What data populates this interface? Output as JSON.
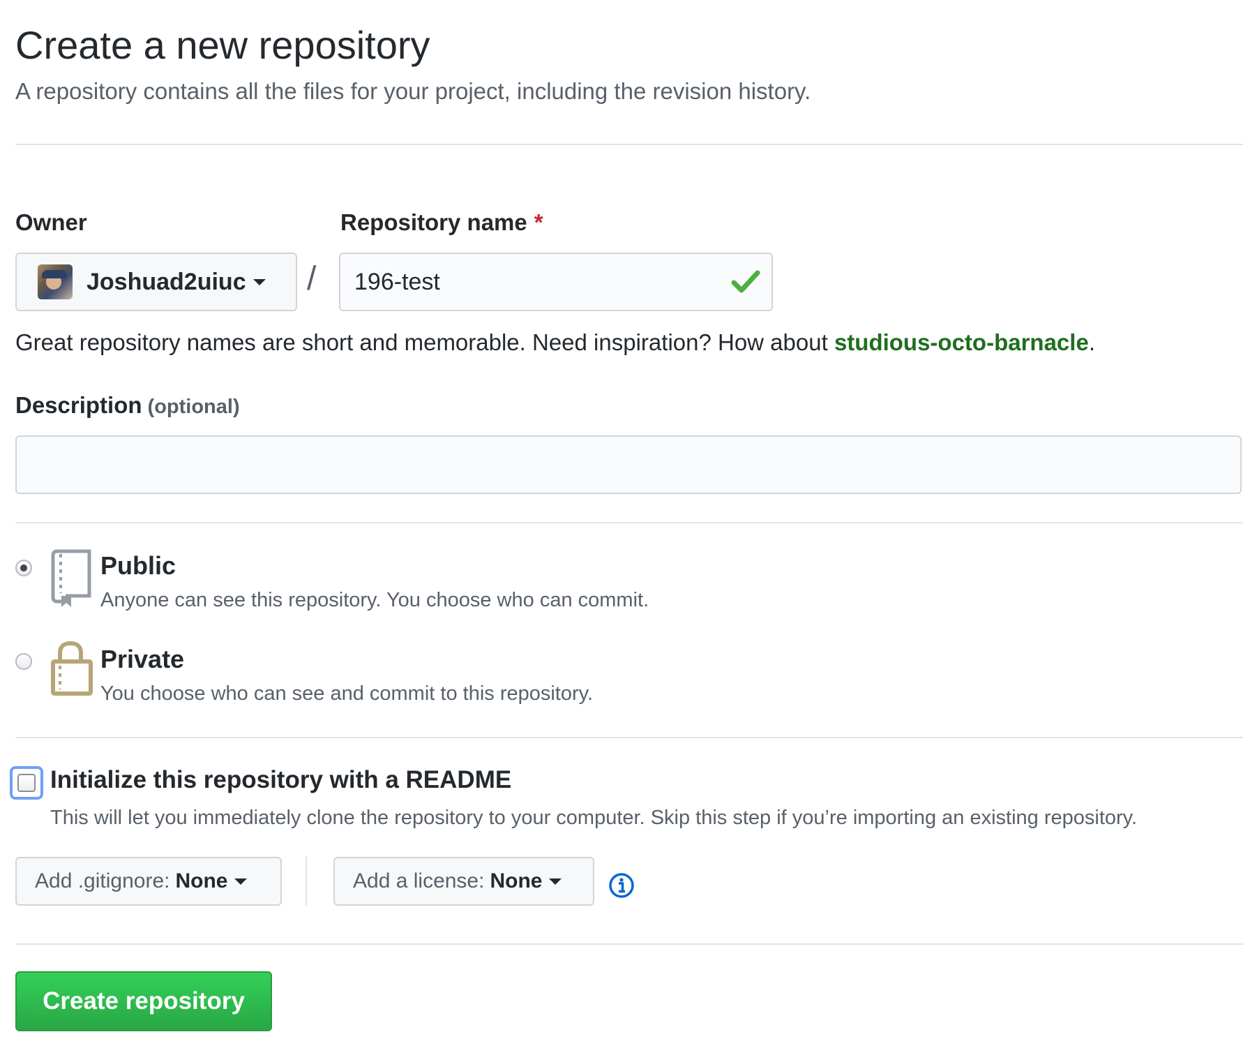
{
  "header": {
    "title": "Create a new repository",
    "subtitle": "A repository contains all the files for your project, including the revision history."
  },
  "owner": {
    "label": "Owner",
    "value": "Joshuad2uiuc"
  },
  "separator": "/",
  "repo_name": {
    "label": "Repository name",
    "required_mark": "*",
    "value": "196-test"
  },
  "hint": {
    "text": "Great repository names are short and memorable. Need inspiration? How about ",
    "suggestion": "studious-octo-barnacle",
    "end": "."
  },
  "description": {
    "label": "Description",
    "optional": "(optional)",
    "value": "",
    "placeholder": ""
  },
  "visibility": {
    "selected": "public",
    "public": {
      "title": "Public",
      "desc": "Anyone can see this repository. You choose who can commit.",
      "icon": "repo-icon"
    },
    "private": {
      "title": "Private",
      "desc": "You choose who can see and commit to this repository.",
      "icon": "lock-icon"
    }
  },
  "init": {
    "checked": false,
    "title": "Initialize this repository with a README",
    "desc": "This will let you immediately clone the repository to your computer. Skip this step if you’re importing an existing repository."
  },
  "gitignore": {
    "label": "Add .gitignore:",
    "value": "None"
  },
  "license": {
    "label": "Add a license:",
    "value": "None"
  },
  "submit": {
    "label": "Create repository"
  },
  "colors": {
    "accent_green": "#28a745",
    "suggestion_green": "#1f6e1f",
    "required_red": "#cb2431",
    "info_blue": "#0366d6",
    "lock_tan": "#b8a577"
  }
}
